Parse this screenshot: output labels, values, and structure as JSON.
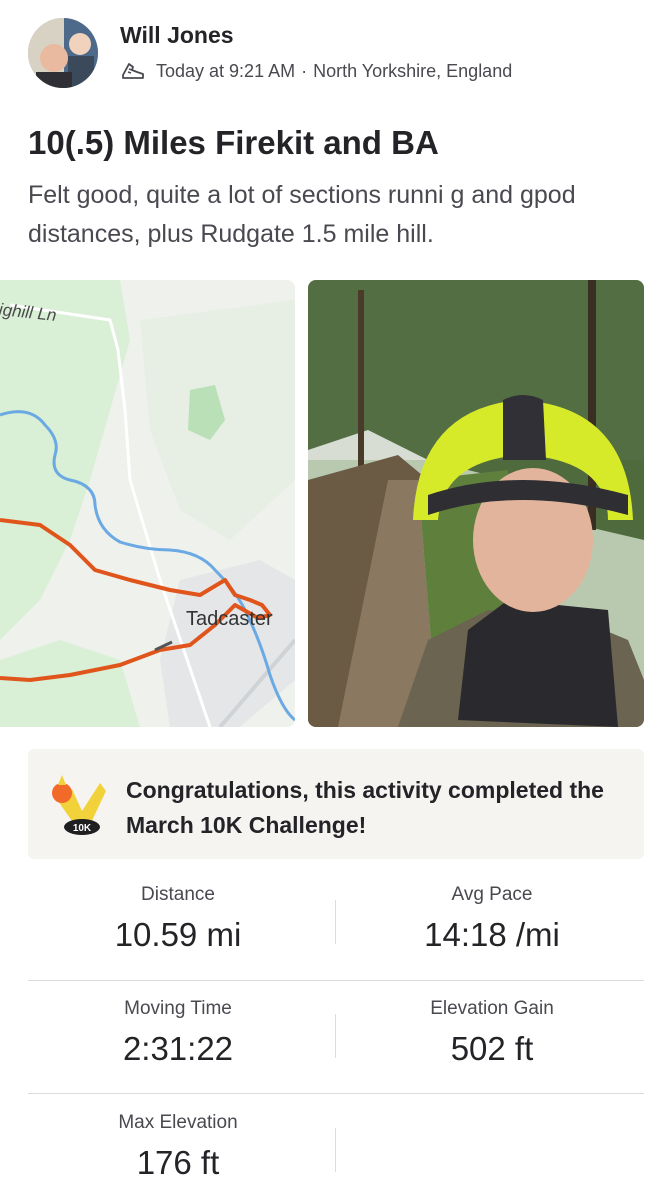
{
  "activity": {
    "athlete_name": "Will Jones",
    "timestamp": "Today at 9:21 AM",
    "location": "North Yorkshire, England",
    "meta_separator": "·",
    "title": "10(.5) Miles Firekit and BA",
    "description": "Felt good, quite a lot of sections runni g and gpod distances, plus Rudgate 1.5 mile hill.",
    "activity_icon": "run-shoe-icon"
  },
  "map": {
    "road_label": "ighill Ln",
    "town_label": "Tadcaster",
    "route_color": "#e0551b",
    "river_color": "#6aa9e3"
  },
  "challenge": {
    "message": "Congratulations, this activity completed the March 10K Challenge!",
    "badge_text": "10K"
  },
  "stats": [
    {
      "label": "Distance",
      "value": "10.59 mi"
    },
    {
      "label": "Avg Pace",
      "value": "14:18 /mi"
    },
    {
      "label": "Moving Time",
      "value": "2:31:22"
    },
    {
      "label": "Elevation Gain",
      "value": "502 ft"
    },
    {
      "label": "Max Elevation",
      "value": "176 ft"
    }
  ]
}
